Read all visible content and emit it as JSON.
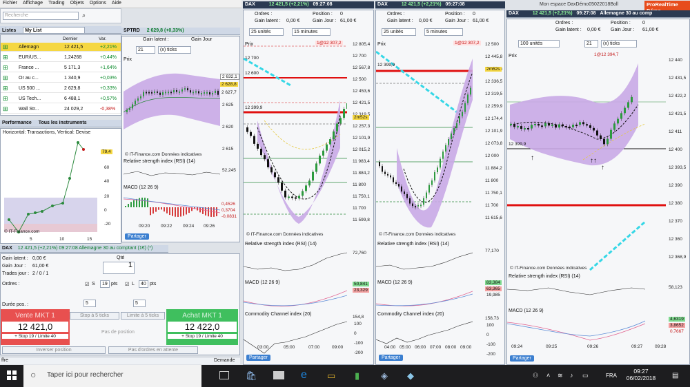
{
  "menu": [
    "Fichier",
    "Affichage",
    "Trading",
    "Objets",
    "Options",
    "Aide"
  ],
  "search_placeholder": "Recherche",
  "lists": {
    "title": "Listes",
    "selected": "My List",
    "headers": [
      "",
      "",
      "Dernier",
      "Var."
    ],
    "rows": [
      {
        "name": "Allemagn",
        "last": "12 421,5",
        "chg": "+2,21%",
        "dir": "pos"
      },
      {
        "name": "EUR/US...",
        "last": "1,24268",
        "chg": "+0,44%",
        "dir": "pos"
      },
      {
        "name": "France ...",
        "last": "5 171,3",
        "chg": "+1,64%",
        "dir": "pos"
      },
      {
        "name": "Or au c...",
        "last": "1 340,9",
        "chg": "+0,03%",
        "dir": "pos"
      },
      {
        "name": "US 500 ...",
        "last": "2 629,8",
        "chg": "+0,33%",
        "dir": "pos"
      },
      {
        "name": "US Tech...",
        "last": "6 488,1",
        "chg": "+0,57%",
        "dir": "pos"
      },
      {
        "name": "Wall Str...",
        "last": "24 029,2",
        "chg": "-0,38%",
        "dir": "neg"
      }
    ]
  },
  "spx": {
    "title": "SPTRD",
    "quote": "2 629,8 (+0,33%)",
    "gain_latent": "Gain latent :",
    "gain_jour": "Gain Jour",
    "ticks": "21",
    "ticks_unit": "(x) ticks",
    "price_label": "Prix",
    "last_tag": "2 628,8",
    "axis": [
      "2 632,1",
      "2 627,7",
      "2 625",
      "2 620",
      "2 615"
    ],
    "times": [
      "09:20",
      "09:22",
      "09:24",
      "09:26"
    ],
    "copyright": "© IT-Finance.com Données indicatives",
    "rsi_label": "Relative strength index (RSI) (14)",
    "rsi_value": "52,245",
    "macd_label": "MACD (12 26 9)",
    "macd_values": [
      "0,4526",
      "0,3704",
      "-0,0831"
    ],
    "share": "Partager"
  },
  "performance": {
    "title": "Performance",
    "tab2": "Tous les instruments",
    "heading": "Horizontal: Transactions, Vertical: Devise",
    "value": "79,4",
    "yticks": [
      "60",
      "40",
      "20",
      "0",
      "-20"
    ],
    "xticks": [
      "5",
      "10",
      "15"
    ],
    "copyright": "© IT-Finance.com"
  },
  "order": {
    "title": "DAX",
    "quote": "12 421,5 (+2,21%) 09:27:08 Allemagne 30 au comptant (1€) (*)",
    "rows": [
      {
        "label": "Gain latent :",
        "value": "0,00 €"
      },
      {
        "label": "Gain Jour :",
        "value": "61,00 €"
      },
      {
        "label": "Trades jour :",
        "value": "2 / 0 / 1"
      }
    ],
    "qty_label": "Qté",
    "qty": "1",
    "orders_label": "Ordres :",
    "S_label": "S",
    "S_value": "19",
    "L_label": "L",
    "L_value": "40",
    "unit": "pts",
    "duree_label": "Durée pos. :",
    "spin1": "5",
    "spin2": "5",
    "stop_btn": "Stop à 5 ticks",
    "limit_btn": "Limite à 5 ticks",
    "sell_label": "Vente MKT 1",
    "sell_price": "12 421,0",
    "sell_sub": "+ Stop 19 / Limite 40",
    "buy_label": "Achat MKT 1",
    "buy_price": "12 422,0",
    "buy_sub": "+ Stop 19 / Limite 40",
    "no_pos": "Pas de position",
    "inverse": "Inverser position",
    "no_orders": "Pas d'ordres en attente",
    "footer_left": "ffre",
    "footer_right": "Demande"
  },
  "dax15": {
    "title": "DAX",
    "quote": "12 421,5 (+2,21%)",
    "time": "09:27:08",
    "orders": "Ordres :",
    "gain_latent": "Gain latent :",
    "gain_latent_v": "0,00 €",
    "position": "Position :",
    "position_v": "0",
    "gain_jour": "Gain Jour :",
    "gain_jour_v": "61,00 €",
    "units": "25 unités",
    "interval": "15 minutes",
    "header_tag": "1@12 307,2",
    "price_label": "Prix",
    "axis": [
      "12 805,4",
      "12 700",
      "12 567,8",
      "12 500",
      "12 453,6",
      "12 421,5",
      "12 319,5",
      "12 257,3",
      "12 101,9",
      "12 015,2",
      "11 983,4",
      "11 884,2",
      "11 800",
      "11 750,1",
      "11 700",
      "11 599,8"
    ],
    "left_tags": [
      "12 700",
      "12 600",
      "12 399,9"
    ],
    "pivot_labels": [
      "R2",
      "R1",
      "Piv",
      "S1",
      "S2",
      "mS1",
      "mS2",
      "mR1"
    ],
    "countdown": "2m52s",
    "times": [
      "03:00",
      "05:00",
      "07:00",
      "09:00"
    ],
    "copyright": "© IT-Finance.com Données indicatives",
    "rsi_label": "Relative strength index (RSI) (14)",
    "rsi_value": "72,760",
    "macd_label": "MACD (12 26 9)",
    "macd_values": [
      "50,841",
      "23,329"
    ],
    "cci_label": "Commodity Channel index (20)",
    "cci_values": [
      "154,8",
      "100",
      "0",
      "-100",
      "-200"
    ],
    "share": "Partager"
  },
  "dax5": {
    "title": "DAX",
    "quote": "12 421,5 (+2,21%)",
    "time": "09:27:08",
    "orders": "Ordres :",
    "gain_latent": "Gain latent :",
    "gain_latent_v": "0,00 €",
    "position": "Position :",
    "position_v": "0",
    "gain_jour": "Gain Jour :",
    "gain_jour_v": "61,00 €",
    "units": "25 unités",
    "interval": "5 minutes",
    "header_tag": "1@12 307,2",
    "price_label": "Prix",
    "axis": [
      "12 500",
      "12 445,8",
      "12 421,5",
      "12 336,5",
      "12 319,5",
      "12 259,9",
      "12 174,4",
      "12 101,9",
      "12 073,8",
      "12 000",
      "11 884,2",
      "11 800",
      "11 750,1",
      "11 700",
      "11 615,6"
    ],
    "left_tag": "12 399,9",
    "countdown": "2m52s",
    "times": [
      "04:00",
      "05:00",
      "06:00",
      "07:00",
      "08:00",
      "09:00"
    ],
    "copyright": "© IT-Finance.com Données indicatives",
    "rsi_label": "Relative strength index (RSI) (14)",
    "rsi_value": "77,170",
    "macd_label": "MACD (12 26 9)",
    "macd_values": [
      "83,384",
      "63,365",
      "19,985"
    ],
    "cci_label": "Commodity Channel index (20)",
    "cci_values": [
      "158,73",
      "100",
      "0",
      "-100",
      "-200"
    ],
    "share": "Partager"
  },
  "dax1": {
    "window_title": "DAX",
    "quote": "12 421,5 (+2,21%)",
    "time": "09:27:08",
    "desc": "Allemagne 30 au comp",
    "workspace": "Mon espace DaxDémo05022018Boll",
    "brand": "ProRealTime Démo",
    "orders": "Ordres :",
    "gain_latent": "Gain latent :",
    "gain_latent_v": "0,00 €",
    "position": "Position :",
    "position_v": "0",
    "gain_jour": "Gain Jour :",
    "gain_jour_v": "61,00 €",
    "units": "100 unités",
    "ticks": "21",
    "ticks_unit": "(x) ticks",
    "header_tag": "1@12 394,7",
    "price_label": "Prix",
    "axis": [
      "12 440",
      "12 431,5",
      "12 422,2",
      "12 421,5",
      "12 411",
      "12 400",
      "12 393,5",
      "12 390",
      "12 380",
      "12 370",
      "12 360",
      "12 368,9"
    ],
    "left_tag": "12 399,9",
    "times": [
      "09:24",
      "09:25",
      "09:26",
      "09:27",
      "09:28"
    ],
    "copyright": "© IT-Finance.com Données indicatives",
    "rsi_label": "Relative strength index (RSI) (14)",
    "rsi_value": "58,123",
    "macd_label": "MACD (12 26 9)",
    "macd_values": [
      "4,6319",
      "3,8652",
      "0,7667"
    ],
    "share": "Partager"
  },
  "taskbar": {
    "search": "Taper ici pour rechercher",
    "lang": "FRA",
    "clock_time": "09:27",
    "clock_date": "06/02/2018"
  }
}
